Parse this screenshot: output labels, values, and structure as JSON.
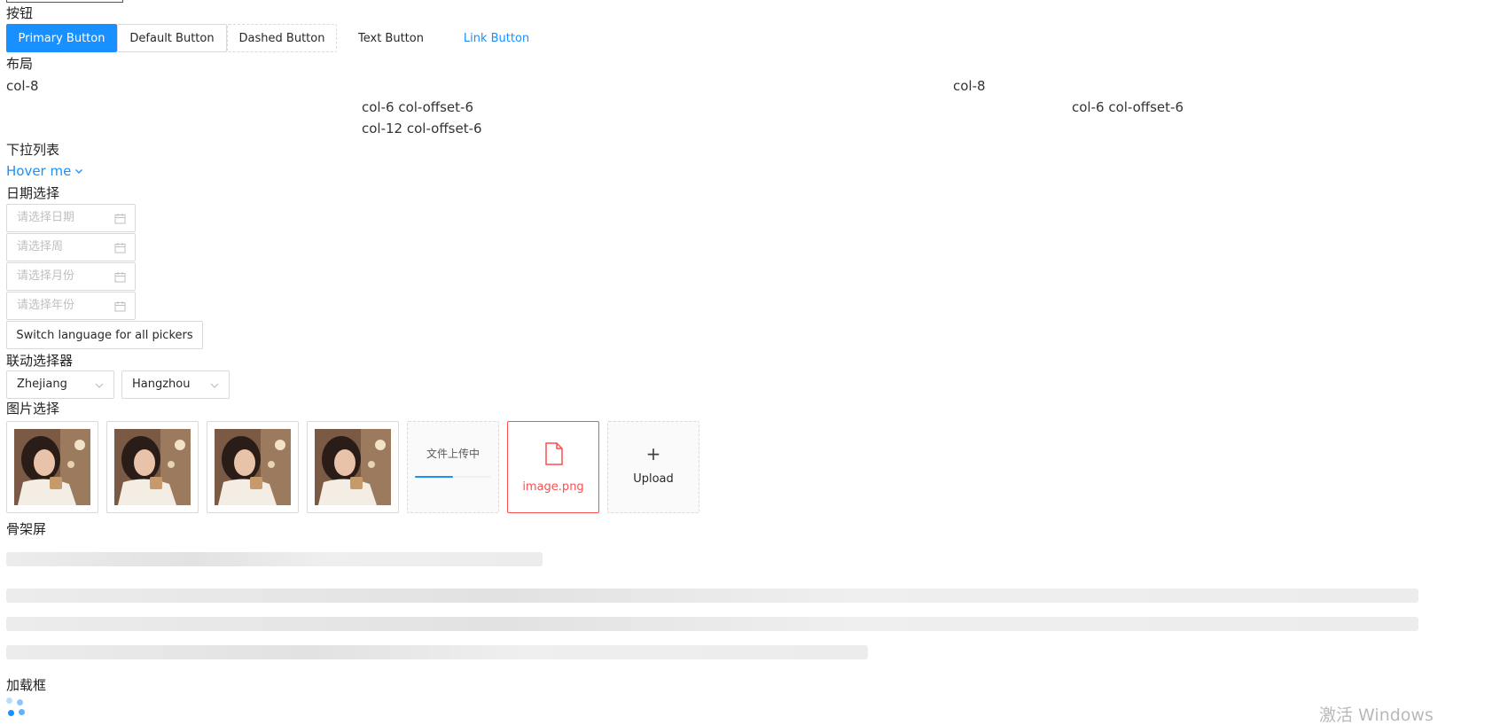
{
  "sections": {
    "buttons": "按钮",
    "layout": "布局",
    "dropdown": "下拉列表",
    "date": "日期选择",
    "cascader": "联动选择器",
    "upload": "图片选择",
    "skeleton": "骨架屏",
    "loading": "加载框"
  },
  "buttons": {
    "primary": "Primary Button",
    "default": "Default Button",
    "dashed": "Dashed Button",
    "text": "Text Button",
    "link": "Link Button"
  },
  "layout": {
    "row1_left": "col-8",
    "row1_right": "col-8",
    "row2_left": "col-6 col-offset-6",
    "row2_right": "col-6 col-offset-6",
    "row3": "col-12 col-offset-6"
  },
  "dropdown": {
    "trigger": "Hover me"
  },
  "date_pickers": {
    "date": "请选择日期",
    "week": "请选择周",
    "month": "请选择月份",
    "year": "请选择年份",
    "switch_language": "Switch language for all pickers"
  },
  "cascader": {
    "province": "Zhejiang",
    "city": "Hangzhou"
  },
  "upload": {
    "uploading_text": "文件上传中",
    "uploading_progress": 0.5,
    "error_file": "image.png",
    "upload_label": "Upload",
    "plus": "+"
  },
  "icons": {
    "calendar": "calendar-icon",
    "chevron": "chevron-down-icon",
    "file": "file-icon",
    "plus": "plus-icon",
    "spinner": "loading-spinner-icon"
  },
  "colors": {
    "primary": "#1890ff",
    "error": "#ff4d4f",
    "border": "#d9d9d9",
    "placeholder": "#bfbfbf"
  },
  "watermark": "激活 Windows"
}
